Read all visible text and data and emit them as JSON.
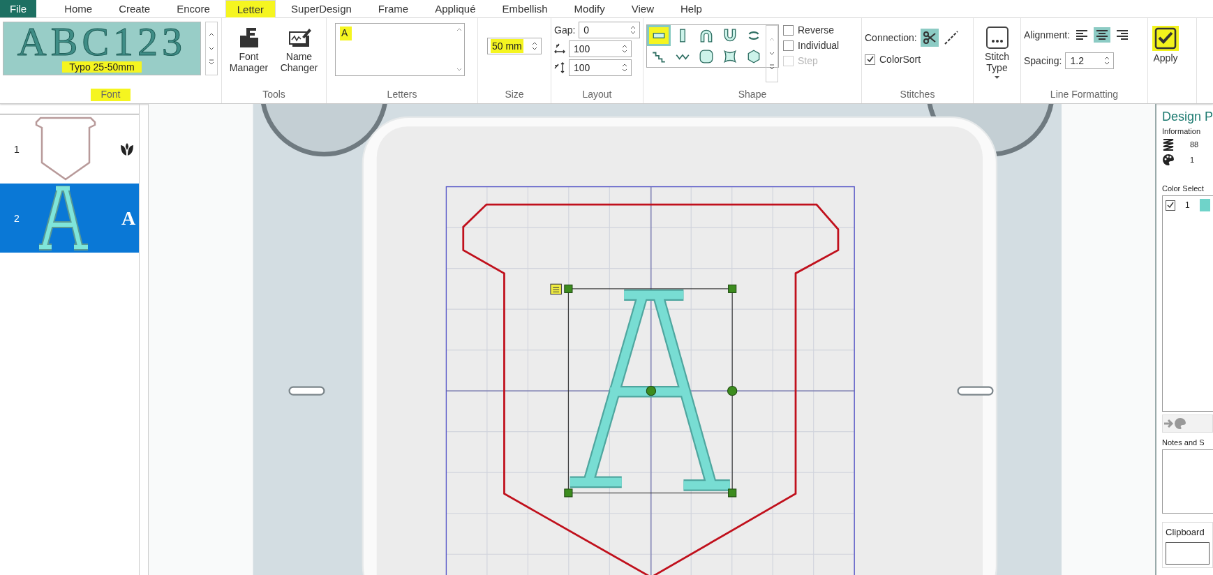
{
  "tabs": [
    {
      "label": "File",
      "kind": "file",
      "selected": false,
      "highlighted": false
    },
    {
      "label": "Home",
      "kind": "tab",
      "selected": false,
      "highlighted": false
    },
    {
      "label": "Create",
      "kind": "tab",
      "selected": false,
      "highlighted": false
    },
    {
      "label": "Encore",
      "kind": "tab",
      "selected": false,
      "highlighted": false
    },
    {
      "label": "Letter",
      "kind": "tab",
      "selected": true,
      "highlighted": true
    },
    {
      "label": "SuperDesign",
      "kind": "tab",
      "selected": false,
      "highlighted": false
    },
    {
      "label": "Frame",
      "kind": "tab",
      "selected": false,
      "highlighted": false
    },
    {
      "label": "Appliqué",
      "kind": "tab",
      "selected": false,
      "highlighted": false
    },
    {
      "label": "Embellish",
      "kind": "tab",
      "selected": false,
      "highlighted": false
    },
    {
      "label": "Modify",
      "kind": "tab",
      "selected": false,
      "highlighted": false
    },
    {
      "label": "View",
      "kind": "tab",
      "selected": false,
      "highlighted": false
    },
    {
      "label": "Help",
      "kind": "tab",
      "selected": false,
      "highlighted": false
    }
  ],
  "ribbon": {
    "font": {
      "preview": "ABC123",
      "name": "Typo 25-50mm",
      "name_highlighted": true,
      "label": "Font",
      "label_highlighted": true
    },
    "tools": {
      "buttons": [
        {
          "label": "Font Manager",
          "kind": "font-manager"
        },
        {
          "label": "Name Changer",
          "kind": "name-changer"
        }
      ],
      "label": "Tools"
    },
    "letters": {
      "value": "A",
      "highlighted": true,
      "label": "Letters"
    },
    "size": {
      "value": "50 mm",
      "highlighted": true,
      "label": "Size"
    },
    "layout": {
      "fields": [
        {
          "kind": "gap",
          "label": "Gap:",
          "value": "0"
        },
        {
          "kind": "width",
          "value": "100"
        },
        {
          "kind": "height",
          "value": "100"
        }
      ],
      "label": "Layout"
    },
    "shape": {
      "shapes": [
        {
          "kind": "line",
          "selected": true,
          "highlighted": true
        },
        {
          "kind": "vertical",
          "selected": false,
          "highlighted": false
        },
        {
          "kind": "arch-up",
          "selected": false,
          "highlighted": false
        },
        {
          "kind": "arch-down",
          "selected": false,
          "highlighted": false
        },
        {
          "kind": "circle",
          "selected": false,
          "highlighted": false
        },
        {
          "kind": "steps",
          "selected": false,
          "highlighted": false
        },
        {
          "kind": "zigzag",
          "selected": false,
          "highlighted": false
        },
        {
          "kind": "rounded",
          "selected": false,
          "highlighted": false
        },
        {
          "kind": "concave",
          "selected": false,
          "highlighted": false
        },
        {
          "kind": "hexagon",
          "selected": false,
          "highlighted": false
        }
      ],
      "options": [
        {
          "label": "Reverse",
          "checked": false,
          "disabled": false
        },
        {
          "label": "Individual",
          "checked": false,
          "disabled": false
        },
        {
          "label": "Step",
          "checked": false,
          "disabled": true
        }
      ],
      "label": "Shape"
    },
    "stitches": {
      "connection_label": "Connection:",
      "connections": [
        {
          "kind": "trim",
          "selected": true
        },
        {
          "kind": "jump",
          "selected": false
        }
      ],
      "colorsort": {
        "label": "ColorSort",
        "checked": true
      },
      "label": "Stitches"
    },
    "stitch_type": {
      "label": "Stitch Type"
    },
    "line_formatting": {
      "alignment_label": "Alignment:",
      "alignments": [
        {
          "kind": "left",
          "selected": false
        },
        {
          "kind": "center",
          "selected": true
        },
        {
          "kind": "right",
          "selected": false
        }
      ],
      "spacing_label": "Spacing:",
      "spacing": "1.2",
      "label": "Line Formatting"
    },
    "apply": {
      "label": "Apply",
      "highlighted": true
    }
  },
  "objects": [
    {
      "number": "1",
      "kind": "applique",
      "selected": false
    },
    {
      "number": "2",
      "kind": "letter",
      "letter": "A",
      "selected": true
    }
  ],
  "design_panel": {
    "title": "Design P",
    "information_label": "Information",
    "stitches": "88",
    "colors": "1",
    "color_select_label": "Color Select",
    "colors_list": [
      {
        "number": "1",
        "checked": true,
        "color": "#6fd3c9"
      }
    ],
    "notes_label": "Notes and S",
    "clipboard_label": "Clipboard"
  }
}
